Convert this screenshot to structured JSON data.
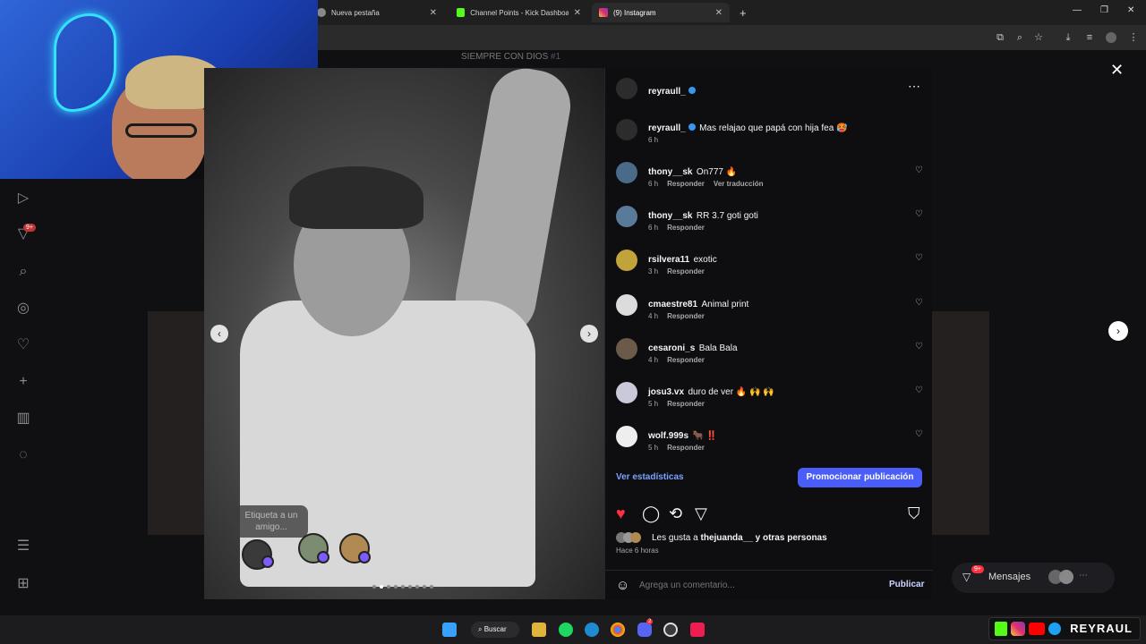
{
  "browser": {
    "tabs": [
      {
        "label": "Nueva pestaña"
      },
      {
        "label": "Channel Points - Kick Dashboard"
      },
      {
        "label": "(9) Instagram"
      }
    ],
    "new_tab": "+"
  },
  "page": {
    "background_caption": "SIEMPRE CON DIOS",
    "background_caption_tag": "#1"
  },
  "left_rail": {
    "notification_badge": "9+"
  },
  "post": {
    "tag_prompt": "Etiqueta a un amigo...",
    "total_images": 9,
    "current_image": 2
  },
  "panel": {
    "author": "reyraull_",
    "caption": {
      "user": "reyraull_",
      "text": "Mas relajao que papá con hija fea 🥵",
      "time": "6 h"
    },
    "comments": [
      {
        "user": "thony__sk",
        "text": "On777 🔥",
        "time": "6 h",
        "reply": "Responder",
        "translate": "Ver traducción"
      },
      {
        "user": "thony__sk",
        "text": "RR 3.7 goti goti",
        "time": "6 h",
        "reply": "Responder"
      },
      {
        "user": "rsilvera11",
        "text": "exotic",
        "time": "3 h",
        "reply": "Responder"
      },
      {
        "user": "cmaestre81",
        "text": "Animal print",
        "time": "4 h",
        "reply": "Responder"
      },
      {
        "user": "cesaroni_s",
        "text": "Bala Bala",
        "time": "4 h",
        "reply": "Responder"
      },
      {
        "user": "josu3.vx",
        "text": "duro de ver 🔥 🙌 🙌",
        "time": "5 h",
        "reply": "Responder"
      },
      {
        "user": "wolf.999s",
        "text": "🐂 ‼️",
        "time": "5 h",
        "reply": "Responder"
      }
    ],
    "stats_link": "Ver estadísticas",
    "promote_button": "Promocionar publicación",
    "likes": {
      "prefix": "Les gusta a",
      "user": "thejuanda__",
      "suffix": "y otras personas"
    },
    "posted_ago": "Hace 6 horas",
    "comment_placeholder": "Agrega un comentario...",
    "publish": "Publicar"
  },
  "overlay": {
    "messages_label": "Mensajes",
    "messages_badge": "9+"
  },
  "taskbar": {
    "search_label": "Buscar",
    "discord_badge": "2"
  },
  "brand_text": "REYRAUL",
  "colors": {
    "accent_blue": "#4a5df9",
    "like_red": "#ff3040",
    "link_blue": "#7aa2ff",
    "verified_blue": "#3897f0"
  }
}
